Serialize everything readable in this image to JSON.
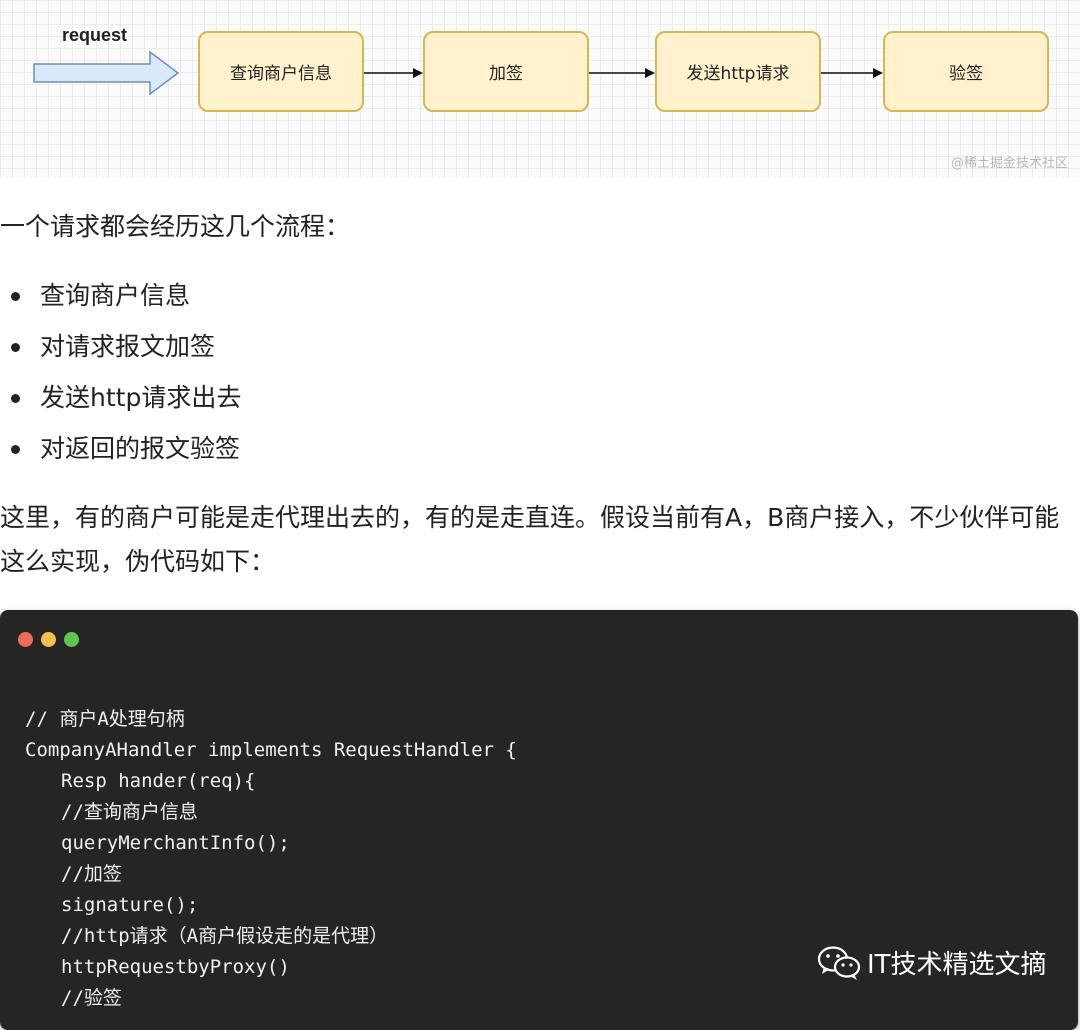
{
  "diagram": {
    "request_label": "request",
    "steps": [
      "查询商户信息",
      "加签",
      "发送http请求",
      "验签"
    ],
    "watermark": "@稀土掘金技术社区",
    "colors": {
      "box_fill": "#fff2cc",
      "box_border": "#d6b656",
      "arrow_fill": "#dae8fc",
      "arrow_border": "#6c8ebf"
    }
  },
  "intro": "一个请求都会经历这几个流程：",
  "steps_list": [
    "查询商户信息",
    "对请求报文加签",
    "发送http请求出去",
    "对返回的报文验签"
  ],
  "paragraph": "这里，有的商户可能是走代理出去的，有的是走直连。假设当前有A，B商户接入，不少伙伴可能这么实现，伪代码如下：",
  "code": {
    "lines": [
      "// 商户A处理句柄",
      "CompanyAHandler implements RequestHandler {",
      "Resp hander(req){",
      "//查询商户信息",
      "queryMerchantInfo();",
      "//加签",
      "signature();",
      "//http请求（A商户假设走的是代理）",
      "httpRequestbyProxy()",
      "//验签"
    ],
    "window_dots": [
      "red",
      "yellow",
      "green"
    ]
  },
  "brand": {
    "icon": "wechat-icon",
    "text": "IT技术精选文摘"
  }
}
